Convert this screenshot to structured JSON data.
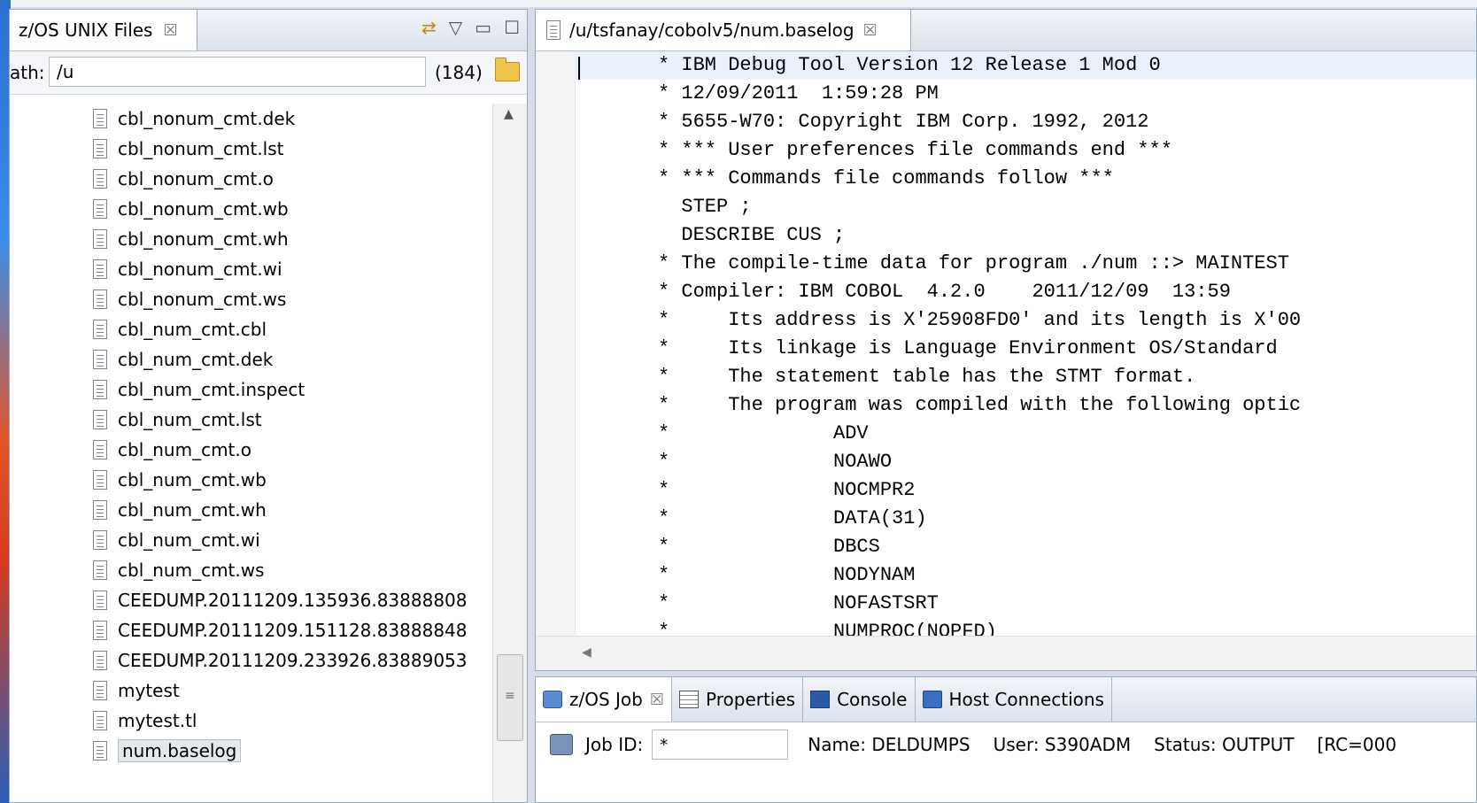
{
  "left_panel": {
    "tab_title": "z/OS UNIX Files",
    "close_glyph": "☒",
    "tools": [
      "sync-icon",
      "chevron-down-icon",
      "minimize-icon",
      "maximize-icon"
    ],
    "path_label": "ath:",
    "path_value": "/u",
    "count": "(184)",
    "files": [
      "cbl_nonum_cmt.dek",
      "cbl_nonum_cmt.lst",
      "cbl_nonum_cmt.o",
      "cbl_nonum_cmt.wb",
      "cbl_nonum_cmt.wh",
      "cbl_nonum_cmt.wi",
      "cbl_nonum_cmt.ws",
      "cbl_num_cmt.cbl",
      "cbl_num_cmt.dek",
      "cbl_num_cmt.inspect",
      "cbl_num_cmt.lst",
      "cbl_num_cmt.o",
      "cbl_num_cmt.wb",
      "cbl_num_cmt.wh",
      "cbl_num_cmt.wi",
      "cbl_num_cmt.ws",
      "CEEDUMP.20111209.135936.83888808",
      "CEEDUMP.20111209.151128.83888848",
      "CEEDUMP.20111209.233926.83889053",
      "mytest",
      "mytest.tl",
      "num.baselog"
    ],
    "selected_file": "num.baselog"
  },
  "editor": {
    "tab_title": "/u/tsfanay/cobolv5/num.baselog",
    "close_glyph": "☒",
    "lines": [
      "* IBM Debug Tool Version 12 Release 1 Mod 0",
      "* 12/09/2011  1:59:28 PM",
      "* 5655-W70: Copyright IBM Corp. 1992, 2012",
      "* *** User preferences file commands end ***",
      "* *** Commands file commands follow ***",
      "  STEP ;",
      "  DESCRIBE CUS ;",
      "* The compile-time data for program ./num ::> MAINTEST",
      "* Compiler: IBM COBOL  4.2.0    2011/12/09  13:59",
      "*     Its address is X'25908FD0' and its length is X'00",
      "*     Its linkage is Language Environment OS/Standard",
      "*     The statement table has the STMT format.",
      "*     The program was compiled with the following optic",
      "*              ADV",
      "*              NOAWO",
      "*              NOCMPR2",
      "*              DATA(31)",
      "*              DBCS",
      "*              NODYNAM",
      "*              NOFASTSRT",
      "*              NUMPROC(NOPFD)"
    ]
  },
  "bottom_panel": {
    "tabs": [
      {
        "label": "z/OS Job",
        "icon": "job-icon",
        "close_glyph": "☒"
      },
      {
        "label": "Properties",
        "icon": "properties-icon"
      },
      {
        "label": "Console",
        "icon": "console-icon"
      },
      {
        "label": "Host Connections",
        "icon": "host-connections-icon"
      }
    ],
    "job_id_label": "Job ID:",
    "job_id_value": "*",
    "name": "Name: DELDUMPS",
    "user": "User: S390ADM",
    "status": "Status: OUTPUT",
    "rc": "[RC=000"
  }
}
